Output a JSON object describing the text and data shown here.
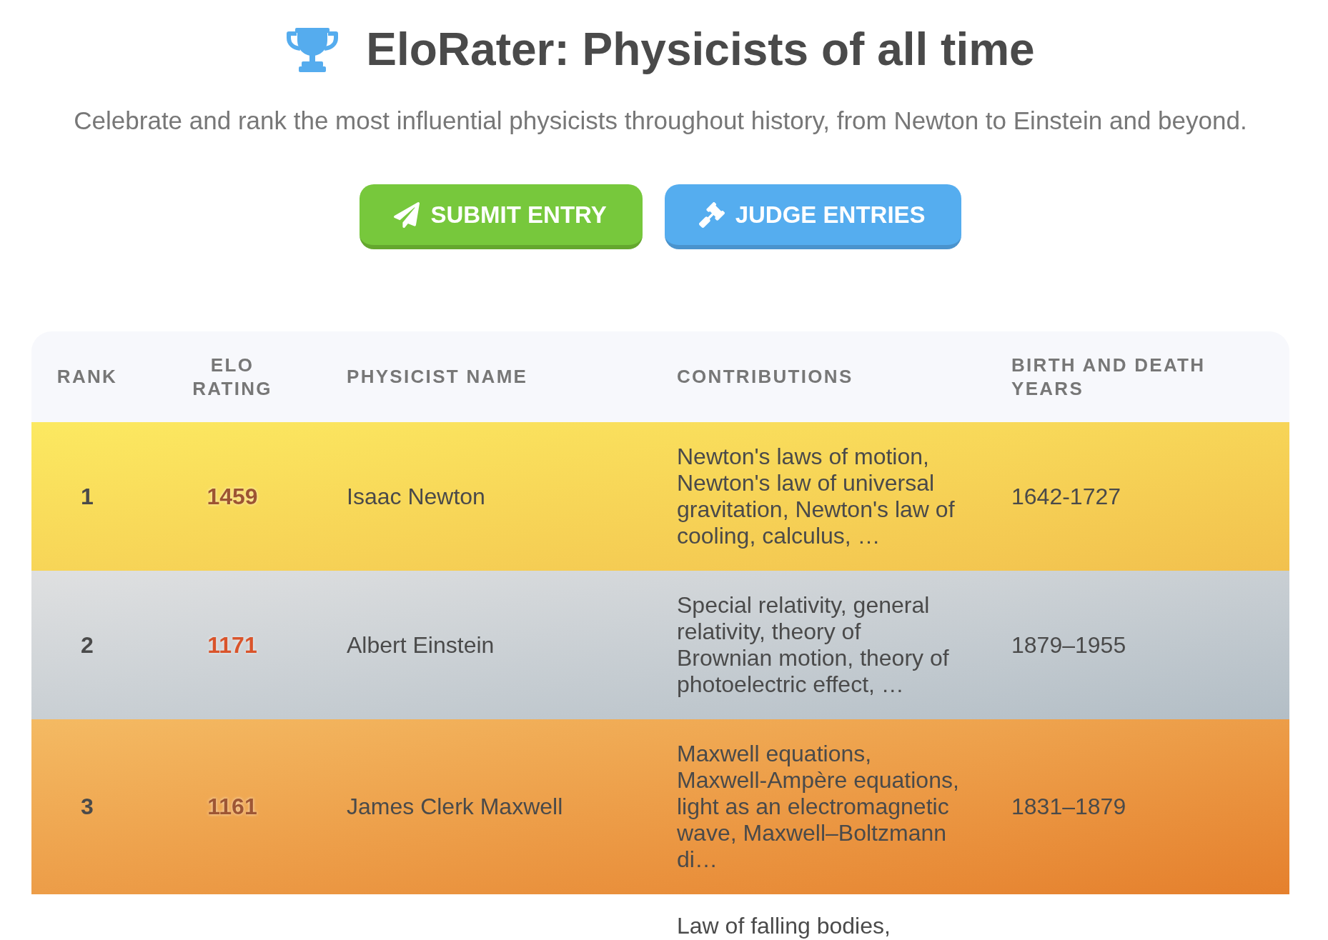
{
  "header": {
    "title": "EloRater: Physicists of all time",
    "subtitle": "Celebrate and rank the most influential physicists throughout history, from Newton to Einstein and beyond."
  },
  "buttons": [
    {
      "kind": "submit",
      "label": "SUBMIT ENTRY"
    },
    {
      "kind": "judge",
      "label": "JUDGE ENTRIES"
    }
  ],
  "table": {
    "columns": [
      "RANK",
      "ELO RATING",
      "PHYSICIST NAME",
      "CONTRIBUTIONS",
      "BIRTH AND DEATH YEARS"
    ],
    "rows": [
      {
        "kind": "gold",
        "rank": "1",
        "rating": "1459",
        "name": "Isaac Newton",
        "contributions": "Newton's laws of motion, Newton's law of universal gravitation, Newton's law of cooling, calculus, …",
        "years": "1642-1727"
      },
      {
        "kind": "silver",
        "rank": "2",
        "rating": "1171",
        "name": "Albert Einstein",
        "contributions": "Special relativity, general relativity, theory of Brownian motion, theory of photoelectric effect, …",
        "years": "1879–1955"
      },
      {
        "kind": "bronze",
        "rank": "3",
        "rating": "1161",
        "name": "James Clerk Maxwell",
        "contributions": "Maxwell equations, Maxwell-Ampère equations, light as an electromagnetic wave, Maxwell–Boltzmann di…",
        "years": "1831–1879"
      },
      {
        "kind": "plain",
        "contributions": "Law of falling bodies,"
      }
    ]
  }
}
